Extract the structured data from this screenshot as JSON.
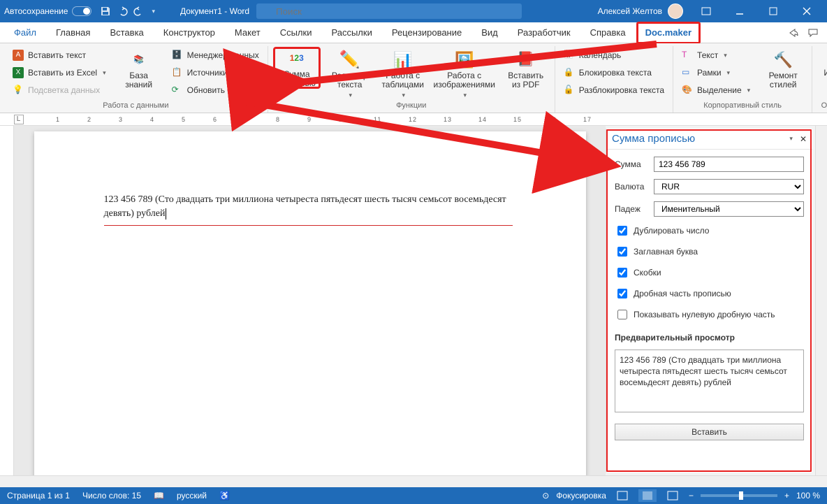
{
  "titlebar": {
    "autosave": "Автосохранение",
    "doc_title": "Документ1 - Word",
    "search_placeholder": "Поиск",
    "user_name": "Алексей Желтов"
  },
  "tabs": {
    "file": "Файл",
    "home": "Главная",
    "insert": "Вставка",
    "design": "Конструктор",
    "layout": "Макет",
    "references": "Ссылки",
    "mailings": "Рассылки",
    "review": "Рецензирование",
    "view": "Вид",
    "developer": "Разработчик",
    "help": "Справка",
    "docmaker": "Doc.maker"
  },
  "ribbon": {
    "g1": {
      "insert_text": "Вставить текст",
      "insert_excel": "Вставить из Excel",
      "highlight": "Подсветка данных",
      "kb": "База\nзнаний",
      "data_mgr": "Менеджер данных",
      "sources": "Источники",
      "refresh": "Обновить связи",
      "label": "Работа с данными"
    },
    "g2": {
      "sum": "Сумма\nпрописью",
      "editor": "Редактор\nтекста",
      "tables": "Работа с\nтаблицами",
      "images": "Работа с\nизображениями",
      "pdf": "Вставить\nиз PDF",
      "label": "Функции"
    },
    "g3": {
      "calendar": "Календарь",
      "lock": "Блокировка текста",
      "unlock": "Разблокировка текста"
    },
    "g4": {
      "text": "Текст",
      "frames": "Рамки",
      "highlight": "Выделение",
      "repair": "Ремонт\nстилей",
      "label": "Корпоративный стиль"
    },
    "g5": {
      "info": "Информация",
      "label": "Обратная связь"
    }
  },
  "document": {
    "text": "123 456 789 (Сто двадцать три миллиона четыреста пятьдесят шесть тысяч семьсот восемьдесят девять) рублей"
  },
  "pane": {
    "title": "Сумма прописью",
    "sum_label": "Сумма",
    "sum_value": "123 456 789",
    "currency_label": "Валюта",
    "currency_value": "RUR",
    "case_label": "Падеж",
    "case_value": "Именительный",
    "chk_dup": "Дублировать число",
    "chk_cap": "Заглавная буква",
    "chk_brackets": "Скобки",
    "chk_fraction": "Дробная часть прописью",
    "chk_showzero": "Показывать нулевую дробную часть",
    "preview_label": "Предварительный просмотр",
    "preview_text": "123 456 789 (Сто двадцать три миллиона четыреста пятьдесят шесть тысяч семьсот восемьдесят девять) рублей",
    "insert": "Вставить"
  },
  "status": {
    "page": "Страница 1 из 1",
    "words": "Число слов: 15",
    "lang": "русский",
    "focus": "Фокусировка",
    "zoom": "100 %"
  }
}
